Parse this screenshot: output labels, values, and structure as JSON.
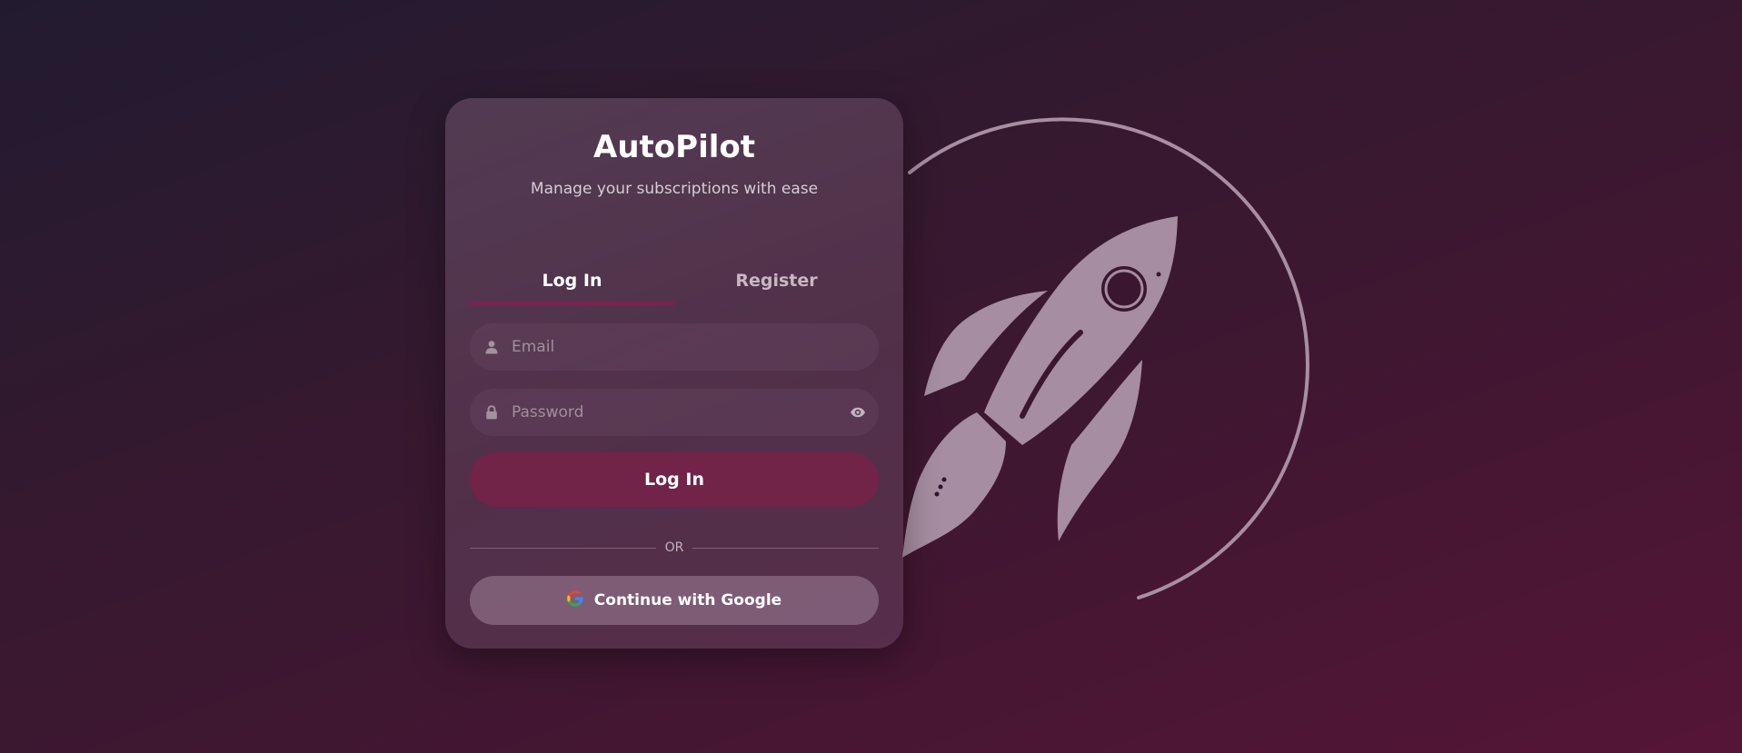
{
  "app": {
    "title": "AutoPilot",
    "subtitle": "Manage your subscriptions with ease"
  },
  "tabs": [
    {
      "label": "Log In",
      "active": true
    },
    {
      "label": "Register",
      "active": false
    }
  ],
  "form": {
    "email_placeholder": "Email",
    "email_value": "",
    "password_placeholder": "Password",
    "password_value": "",
    "email_icon": "user-icon",
    "password_icon": "lock-icon",
    "toggle_icon": "eye-icon"
  },
  "actions": {
    "login_label": "Log In",
    "divider_label": "OR",
    "google_label": "Continue with Google",
    "google_icon": "google-icon"
  },
  "colors": {
    "accent": "#722348",
    "tab_underline": "#7a2350",
    "background_start": "#221b30",
    "background_end": "#551536"
  },
  "illustration": "rocket-icon"
}
